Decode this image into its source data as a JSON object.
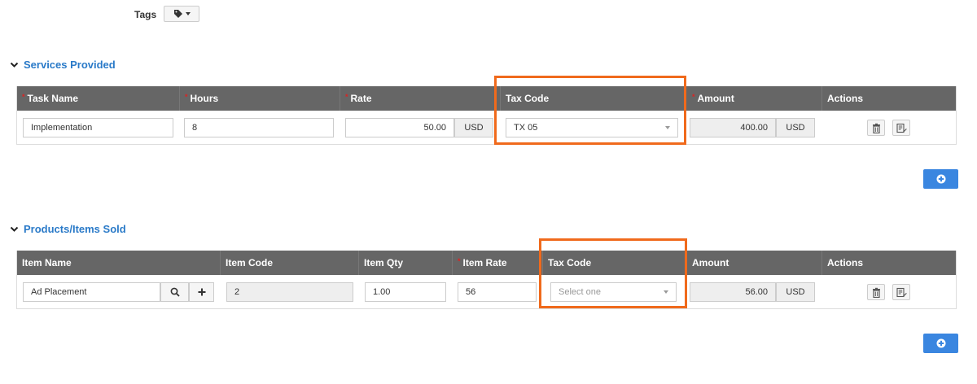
{
  "tags": {
    "label": "Tags"
  },
  "services": {
    "title": "Services Provided",
    "headers": {
      "task_name": "Task Name",
      "hours": "Hours",
      "rate": "Rate",
      "tax_code": "Tax Code",
      "amount": "Amount",
      "actions": "Actions"
    },
    "row": {
      "task_name": "Implementation",
      "hours": "8",
      "rate": "50.00",
      "rate_currency": "USD",
      "tax_code": "TX 05",
      "amount": "400.00",
      "amount_currency": "USD"
    }
  },
  "products": {
    "title": "Products/Items Sold",
    "headers": {
      "item_name": "Item Name",
      "item_code": "Item Code",
      "item_qty": "Item Qty",
      "item_rate": "Item Rate",
      "tax_code": "Tax Code",
      "amount": "Amount",
      "actions": "Actions"
    },
    "row": {
      "item_name": "Ad Placement",
      "item_code": "2",
      "item_qty": "1.00",
      "item_rate": "56",
      "tax_code_placeholder": "Select one",
      "amount": "56.00",
      "amount_currency": "USD"
    }
  },
  "colors": {
    "accent": "#2a7ac8",
    "header_bg": "#666666",
    "add_button": "#3a86e0",
    "highlight": "#f06a1c",
    "required": "#dd2222"
  }
}
